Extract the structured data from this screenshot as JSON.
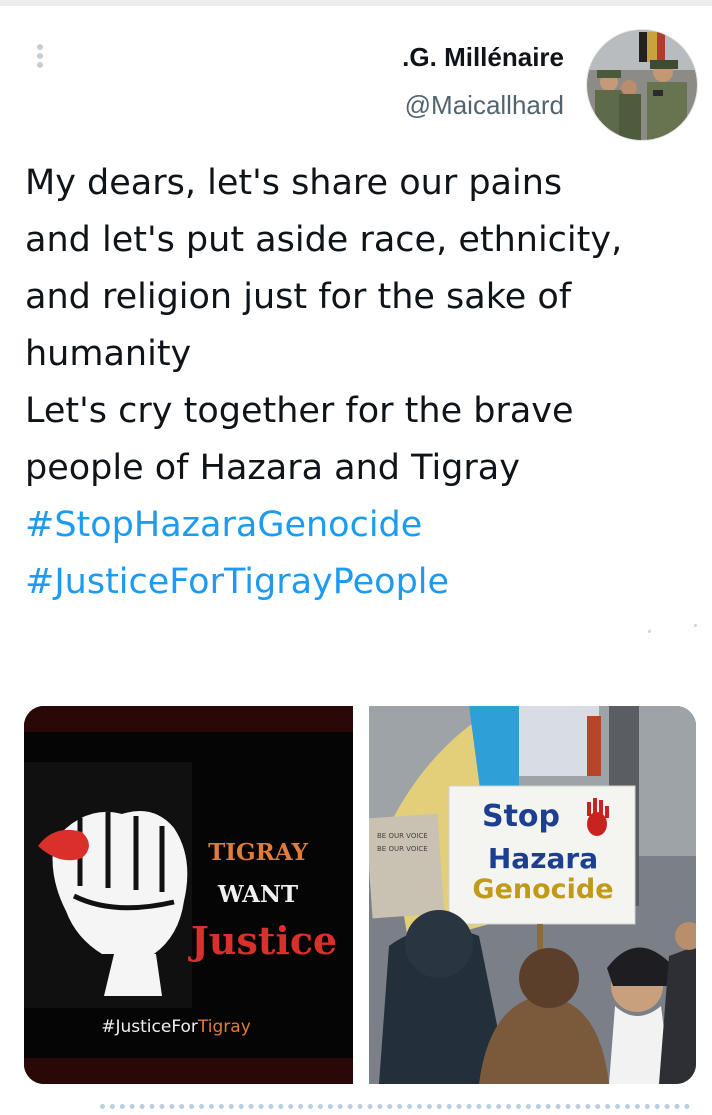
{
  "tweet": {
    "author": {
      "display_name": ".G. Millénaire",
      "handle": "@Maicallhard",
      "avatar_icon": "avatar-soldiers-photo"
    },
    "more_icon": "vertical-ellipsis-icon",
    "text_lines": [
      "My dears, let's share our pains",
      "and let's put aside race, ethnicity,",
      "and religion just for the sake of",
      "humanity",
      "Let's cry together for the brave",
      "people of Hazara and Tigray"
    ],
    "hashtags": [
      "#StopHazaraGenocide",
      "#JusticeForTigrayPeople"
    ],
    "link_color": "#1d9bf0"
  },
  "media": {
    "left_image": {
      "line1": "TIGRAY",
      "line2": "WANT",
      "line3": "Justice",
      "tag_prefix": "#JusticeFor",
      "tag_suffix": "Tigray",
      "accent_color": "#d9302c",
      "tag_suffix_color": "#e07b3a"
    },
    "right_image": {
      "sign_line1": "Stop",
      "sign_line2": "Hazara",
      "sign_line3": "Genocide",
      "sign_blue": "#1c3f8f",
      "sign_gold": "#c29a1a"
    }
  }
}
